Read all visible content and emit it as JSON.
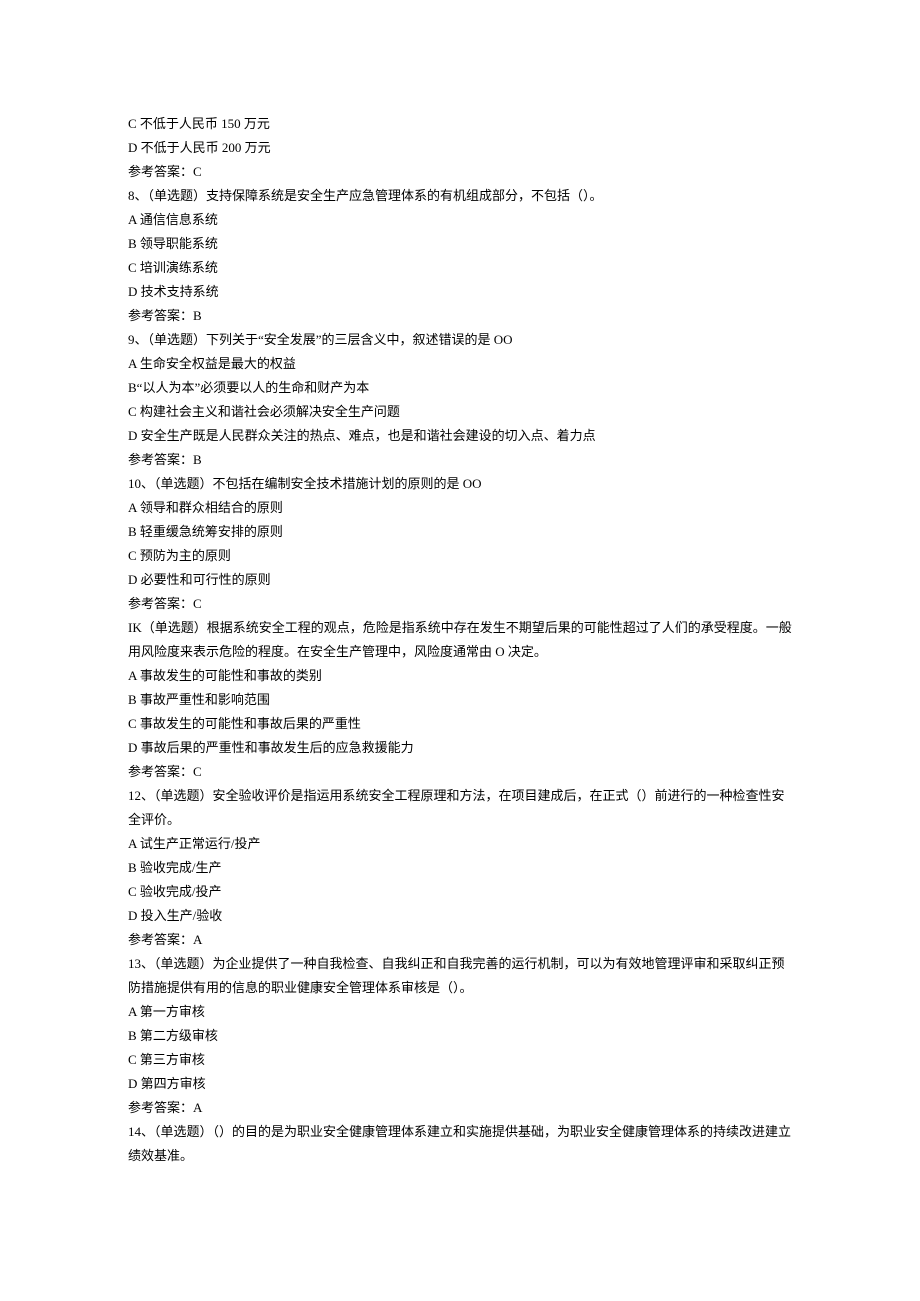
{
  "lines": [
    "C 不低于人民币 150 万元",
    "D 不低于人民币 200 万元",
    "参考答案：C",
    "8、（单选题）支持保障系统是安全生产应急管理体系的有机组成部分，不包括（）。",
    "A 通信信息系统",
    "B 领导职能系统",
    "C 培训演练系统",
    "D 技术支持系统",
    "参考答案：B",
    "9、（单选题）下列关于“安全发展”的三层含义中，叙述错误的是 OO",
    "A 生命安全权益是最大的权益",
    "B“以人为本”必须要以人的生命和财产为本",
    "C 构建社会主义和谐社会必须解决安全生产问题",
    "D 安全生产既是人民群众关注的热点、难点，也是和谐社会建设的切入点、着力点",
    "参考答案：B",
    "10、（单选题）不包括在编制安全技术措施计划的原则的是 OO",
    "A 领导和群众相结合的原则",
    "B 轻重缓急统筹安排的原则",
    "C 预防为主的原则",
    "D 必要性和可行性的原则",
    "参考答案：C",
    "IK（单选题）根据系统安全工程的观点，危险是指系统中存在发生不期望后果的可能性超过了人们的承受程度。一般用风险度来表示危险的程度。在安全生产管理中，风险度通常由 O 决定。",
    "A 事故发生的可能性和事故的类别",
    "B 事故严重性和影响范围",
    "C 事故发生的可能性和事故后果的严重性",
    "D 事故后果的严重性和事故发生后的应急救援能力",
    "参考答案：C",
    "12、（单选题）安全验收评价是指运用系统安全工程原理和方法，在项目建成后，在正式（）前进行的一种检查性安全评价。",
    "A 试生产正常运行/投产",
    "B 验收完成/生产",
    "C 验收完成/投产",
    "D 投入生产/验收",
    "参考答案：A",
    "13、（单选题）为企业提供了一种自我检查、自我纠正和自我完善的运行机制，可以为有效地管理评审和采取纠正预防措施提供有用的信息的职业健康安全管理体系审核是（）。",
    "A 第一方审核",
    "B 第二方级审核",
    "C 第三方审核",
    "D 第四方审核",
    "参考答案：A",
    "14、（单选题）（）的目的是为职业安全健康管理体系建立和实施提供基础，为职业安全健康管理体系的持续改进建立绩效基准。"
  ]
}
